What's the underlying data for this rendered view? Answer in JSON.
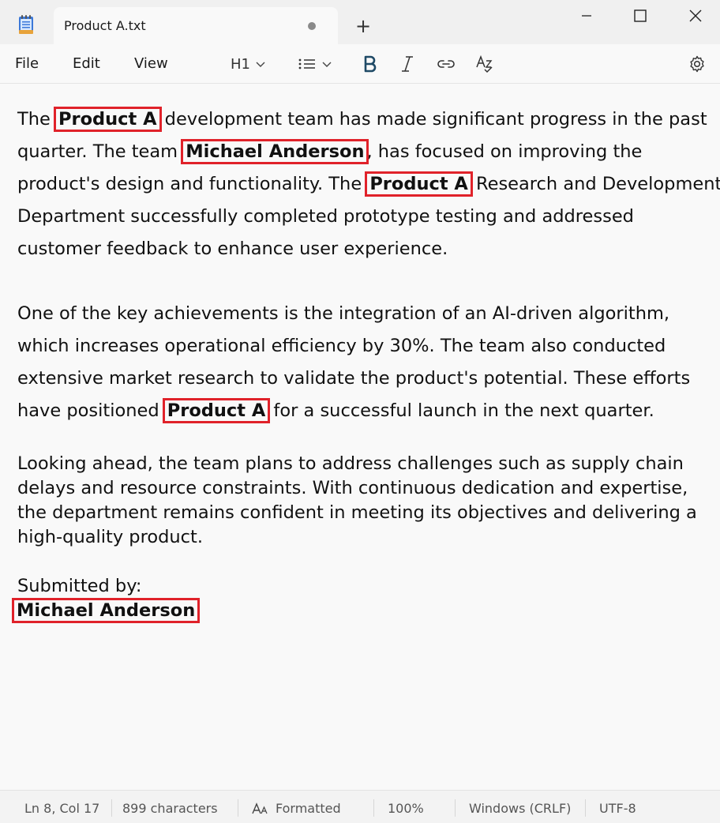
{
  "window": {
    "tab_title": "Product A.txt",
    "new_tab_symbol": "+"
  },
  "menu": {
    "file": "File",
    "edit": "Edit",
    "view": "View"
  },
  "toolbar": {
    "heading": "H1"
  },
  "document": {
    "p1": {
      "l1a": "The ",
      "l1b": "Product A",
      "l1c": " development team has made significant progress in the past",
      "l2a": "quarter. The team ",
      "l2b": "Michael Anderson",
      "l2c": ", has focused on improving the",
      "l3a": "product's design and functionality. The ",
      "l3b": "Product A",
      "l3c": " Research and Development",
      "l4": "Department successfully completed prototype testing and addressed",
      "l5": "customer feedback to enhance user experience."
    },
    "p2": {
      "l1": "One of the key achievements is the integration of an AI-driven algorithm,",
      "l2": "which increases operational efficiency by 30%. The team also conducted",
      "l3": "extensive market research to validate the product's potential. These efforts",
      "l4a": "have positioned ",
      "l4b": "Product A",
      "l4c": " for a successful launch in the next quarter."
    },
    "p3": {
      "l1": "Looking ahead, the team plans to address challenges such as supply chain",
      "l2": "delays and resource constraints. With continuous dedication and expertise,",
      "l3": "the department remains confident in meeting its objectives and delivering a",
      "l4": "high-quality product."
    },
    "signoff": {
      "label": "Submitted by:",
      "name": "Michael Anderson"
    }
  },
  "status": {
    "position": "Ln 8, Col 17",
    "characters": "899 characters",
    "format": "Formatted",
    "zoom": "100%",
    "line_ending": "Windows (CRLF)",
    "encoding": "UTF-8"
  },
  "colors": {
    "highlight_border": "#e0222a"
  }
}
